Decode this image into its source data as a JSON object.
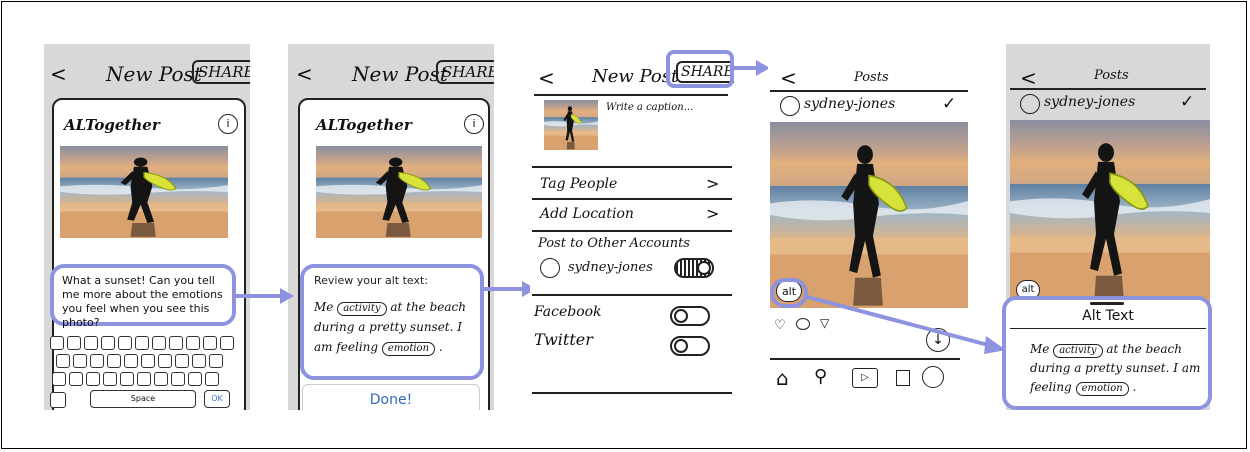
{
  "screen1": {
    "header_back": "<",
    "header_title": "New Post",
    "share_label": "SHARE",
    "app_name": "ALTogether",
    "prompt": "What a sunset! Can you tell me more about the emotions you feel when you see this photo?",
    "space_label": "Space",
    "ok_label": "OK"
  },
  "screen2": {
    "header_back": "<",
    "header_title": "New Post",
    "share_label": "SHARE",
    "app_name": "ALTogether",
    "review_label": "Review your alt text:",
    "alt_pre": "Me",
    "alt_tag1": "activity",
    "alt_mid": "at the beach during a pretty sunset. I am feeling",
    "alt_tag2": "emotion",
    "alt_end": ".",
    "done_label": "Done!"
  },
  "screen3": {
    "header_back": "<",
    "header_title": "New Post",
    "share_label": "SHARE",
    "caption_placeholder": "Write a caption...",
    "tag_people": "Tag People",
    "add_location": "Add Location",
    "post_other": "Post to Other Accounts",
    "account": "sydney-jones",
    "facebook": "Facebook",
    "twitter": "Twitter",
    "chevron": ">"
  },
  "screen4": {
    "header_back": "<",
    "header_title": "Posts",
    "username": "sydney-jones",
    "check": "✓",
    "alt_badge": "alt"
  },
  "screen5": {
    "header_back": "<",
    "header_title": "Posts",
    "username": "sydney-jones",
    "check": "✓",
    "alt_badge": "alt",
    "alt_title": "Alt Text",
    "alt_pre": "Me",
    "alt_tag1": "activity",
    "alt_mid": "at the beach during a pretty sunset. I am feeling",
    "alt_tag2": "emotion",
    "alt_end": "."
  },
  "colors": {
    "accent": "#8d93df"
  }
}
